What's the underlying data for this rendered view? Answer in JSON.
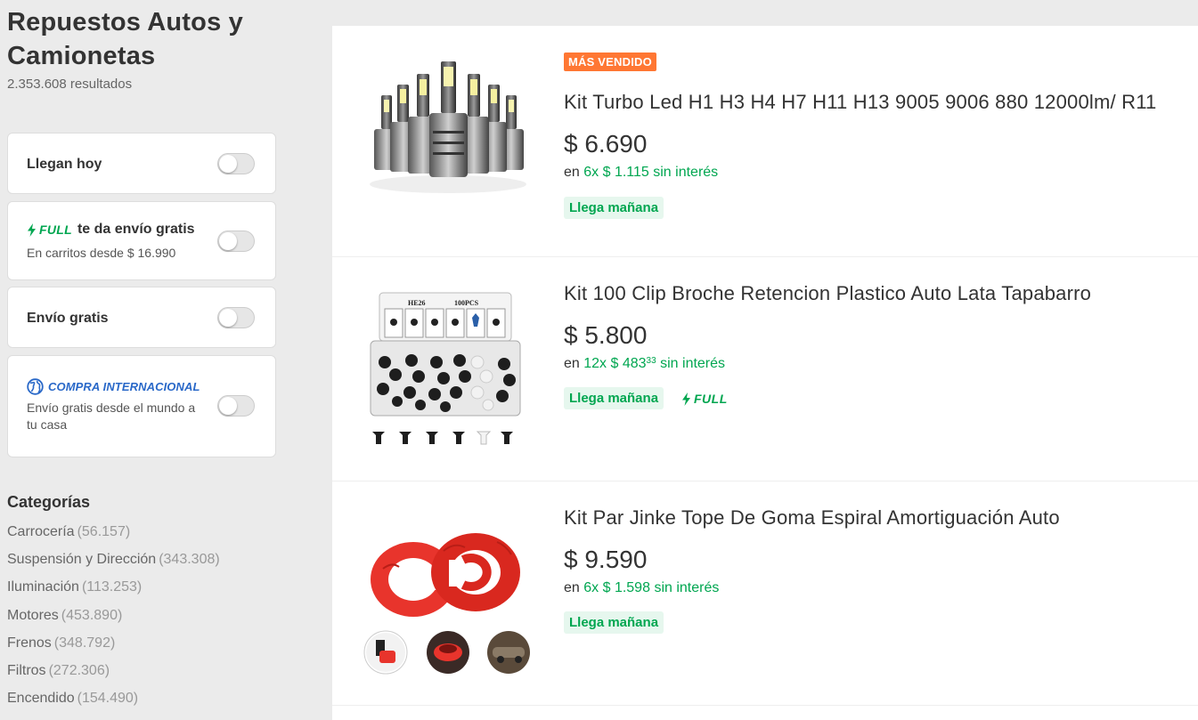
{
  "header": {
    "title": "Repuestos Autos y Camionetas",
    "results_count": "2.353.608 resultados"
  },
  "filters": {
    "llegan_hoy": {
      "label": "Llegan hoy",
      "on": false
    },
    "full": {
      "brand": "FULL",
      "label": "te da envío gratis",
      "sub": "En carritos desde $ 16.990",
      "on": false
    },
    "envio_gratis": {
      "label": "Envío gratis",
      "on": false
    },
    "internacional": {
      "brand": "COMPRA INTERNACIONAL",
      "sub": "Envío gratis desde el mundo a tu casa",
      "on": false
    }
  },
  "categories": {
    "title": "Categorías",
    "items": [
      {
        "name": "Carrocería",
        "count": "(56.157)"
      },
      {
        "name": "Suspensión y Dirección",
        "count": "(343.308)"
      },
      {
        "name": "Iluminación",
        "count": "(113.253)"
      },
      {
        "name": "Motores",
        "count": "(453.890)"
      },
      {
        "name": "Frenos",
        "count": "(348.792)"
      },
      {
        "name": "Filtros",
        "count": "(272.306)"
      },
      {
        "name": "Encendido",
        "count": "(154.490)"
      }
    ]
  },
  "products": [
    {
      "badge": "MÁS VENDIDO",
      "title": "Kit Turbo Led H1 H3 H4 H7 H11 H13 9005 9006 880 12000lm/ R11",
      "price": "$ 6.690",
      "install_prefix": "en",
      "install_terms": "6x $ 1.115",
      "install_cents": "",
      "install_suffix": "sin interés",
      "shipping": "Llega mañana"
    },
    {
      "title": "Kit 100 Clip Broche Retencion Plastico Auto Lata Tapabarro",
      "price": "$ 5.800",
      "install_prefix": "en",
      "install_terms": "12x $ 483",
      "install_cents": "33",
      "install_suffix": "sin interés",
      "shipping": "Llega mañana",
      "full": "FULL",
      "image_label_a": "HE26",
      "image_label_b": "100PCS"
    },
    {
      "title": "Kit Par Jinke Tope De Goma Espiral Amortiguación Auto",
      "price": "$ 9.590",
      "install_prefix": "en",
      "install_terms": "6x $ 1.598",
      "install_cents": "",
      "install_suffix": "sin interés",
      "shipping": "Llega mañana"
    }
  ],
  "colors": {
    "green": "#00a650",
    "badge_orange": "#ff7733",
    "intl_blue": "#2968c8",
    "background": "#ebebeb"
  }
}
